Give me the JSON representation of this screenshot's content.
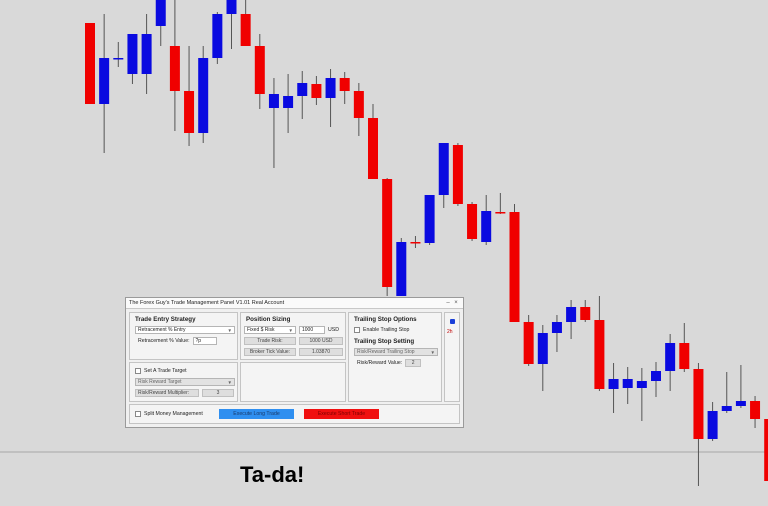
{
  "colors": {
    "background": "#d9d9d9",
    "bull": "#0a0ae0",
    "bear": "#f00000",
    "doji": "#4caf50",
    "wick": "#555555",
    "long_button": "#2f8ff0",
    "short_button": "#f01010"
  },
  "chart_data": {
    "type": "candlestick",
    "candles": [
      {
        "o": 23,
        "h": -12,
        "l": -12,
        "c": 104,
        "bull": false
      },
      {
        "o": 104,
        "h": 14,
        "l": 153,
        "c": 58,
        "bull": true
      },
      {
        "o": 58,
        "h": 42,
        "l": 67,
        "c": 58,
        "bull": true
      },
      {
        "o": 74,
        "h": 63,
        "l": 84,
        "c": 34,
        "bull": true
      },
      {
        "o": 34,
        "h": 14,
        "l": 94,
        "c": 74,
        "bull": true
      },
      {
        "o": 26,
        "h": -12,
        "l": 46,
        "c": -12,
        "bull": true
      },
      {
        "o": 46,
        "h": -12,
        "l": 131,
        "c": 91,
        "bull": false
      },
      {
        "o": 91,
        "h": 46,
        "l": 146,
        "c": 133,
        "bull": false
      },
      {
        "o": 133,
        "h": 46,
        "l": 143,
        "c": 58,
        "bull": true
      },
      {
        "o": 58,
        "h": 12,
        "l": 64,
        "c": 14,
        "bull": true
      },
      {
        "o": 14,
        "h": -12,
        "l": 49,
        "c": -12,
        "bull": true
      },
      {
        "o": 14,
        "h": -12,
        "l": 28,
        "c": 46,
        "bull": false
      },
      {
        "o": 46,
        "h": 34,
        "l": 109,
        "c": 94,
        "bull": false
      },
      {
        "o": 94,
        "h": 78,
        "l": 168,
        "c": 108,
        "bull": true
      },
      {
        "o": 108,
        "h": 74,
        "l": 133,
        "c": 96,
        "bull": true
      },
      {
        "o": 96,
        "h": 71,
        "l": 119,
        "c": 83,
        "bull": true
      },
      {
        "o": 84,
        "h": 76,
        "l": 105,
        "c": 98,
        "bull": false
      },
      {
        "o": 98,
        "h": 69,
        "l": 127,
        "c": 78,
        "bull": true
      },
      {
        "o": 78,
        "h": 72,
        "l": 104,
        "c": 91,
        "bull": false
      },
      {
        "o": 91,
        "h": 83,
        "l": 136,
        "c": 118,
        "bull": false
      },
      {
        "o": 118,
        "h": 104,
        "l": 179,
        "c": 179,
        "bull": false
      },
      {
        "o": 179,
        "h": 178,
        "l": 296,
        "c": 287,
        "bull": false
      },
      {
        "o": 296,
        "h": 238,
        "l": 296,
        "c": 242,
        "bull": true
      },
      {
        "o": 242,
        "h": 236,
        "l": 248,
        "c": 243,
        "bull": false
      },
      {
        "o": 243,
        "h": 195,
        "l": 245,
        "c": 195,
        "bull": true
      },
      {
        "o": 195,
        "h": 156,
        "l": 208,
        "c": 143,
        "bull": true
      },
      {
        "o": 145,
        "h": 143,
        "l": 206,
        "c": 204,
        "bull": false
      },
      {
        "o": 204,
        "h": 202,
        "l": 241,
        "c": 239,
        "bull": false
      },
      {
        "o": 242,
        "h": 195,
        "l": 245,
        "c": 211,
        "bull": true
      },
      {
        "o": 212,
        "h": 193,
        "l": 214,
        "c": 212,
        "bull": false
      },
      {
        "o": 212,
        "h": 204,
        "l": 321,
        "c": 322,
        "bull": false
      },
      {
        "o": 322,
        "h": 315,
        "l": 366,
        "c": 364,
        "bull": false
      },
      {
        "o": 364,
        "h": 325,
        "l": 391,
        "c": 333,
        "bull": true
      },
      {
        "o": 333,
        "h": 315,
        "l": 352,
        "c": 322,
        "bull": true
      },
      {
        "o": 322,
        "h": 300,
        "l": 339,
        "c": 307,
        "bull": true
      },
      {
        "o": 307,
        "h": 300,
        "l": 322,
        "c": 320,
        "bull": false
      },
      {
        "o": 320,
        "h": 296,
        "l": 391,
        "c": 389,
        "bull": false
      },
      {
        "o": 389,
        "h": 363,
        "l": 413,
        "c": 379,
        "bull": true
      },
      {
        "o": 379,
        "h": 367,
        "l": 404,
        "c": 388,
        "bull": true
      },
      {
        "o": 388,
        "h": 368,
        "l": 421,
        "c": 381,
        "bull": true
      },
      {
        "o": 381,
        "h": 362,
        "l": 397,
        "c": 371,
        "bull": true
      },
      {
        "o": 371,
        "h": 334,
        "l": 391,
        "c": 343,
        "bull": true
      },
      {
        "o": 343,
        "h": 323,
        "l": 372,
        "c": 369,
        "bull": false
      },
      {
        "o": 369,
        "h": 363,
        "l": 486,
        "c": 439,
        "bull": false
      },
      {
        "o": 439,
        "h": 402,
        "l": 441,
        "c": 411,
        "bull": true
      },
      {
        "o": 411,
        "h": 372,
        "l": 413,
        "c": 406,
        "bull": true
      },
      {
        "o": 406,
        "h": 365,
        "l": 408,
        "c": 401,
        "bull": true
      },
      {
        "o": 401,
        "h": 396,
        "l": 428,
        "c": 419,
        "bull": false
      },
      {
        "o": 419,
        "h": 406,
        "l": 506,
        "c": 481,
        "bull": false
      },
      {
        "o": 455,
        "h": 410,
        "l": 506,
        "c": 506,
        "bull": false
      }
    ]
  },
  "panel": {
    "title": "The Forex Guy's Trade Management Panel V1.01 Real Account",
    "minimize": "–",
    "close": "×",
    "entry": {
      "header": "Trade Entry Strategy",
      "strategy_value": "Retracement % Entry",
      "retracement_label": "Retracement % Value:",
      "retracement_value": "?p"
    },
    "sizing": {
      "header": "Position Sizing",
      "risk_mode": "Fixed $ Risk",
      "risk_amount": "1000",
      "currency": "USD",
      "trade_risk_label": "Trade Risk:",
      "trade_risk_value": "1000 USD",
      "broker_tick_label": "Broker Tick Value:",
      "broker_tick_value": "1.03870"
    },
    "trailing": {
      "header": "Trailing Stop Options",
      "enable_label": "Enable Trailing Stop",
      "setting_header": "Trailing Stop Setting",
      "method_value": "Risk/Reward Trailing Stop",
      "rr_label": "Risk/Reward Value:",
      "rr_value": "2"
    },
    "side": {
      "timeframe": "2h"
    },
    "target": {
      "set_label": "Set A Trade Target",
      "target_type": "Risk Reward Target",
      "multiplier_label": "Risk/Reward Multiplier:",
      "multiplier_value": "3"
    },
    "footer": {
      "split_label": "Split Money Management",
      "long_button": "Execute Long Trade",
      "short_button": "Execute Short Trade"
    }
  },
  "caption": "Ta-da!"
}
